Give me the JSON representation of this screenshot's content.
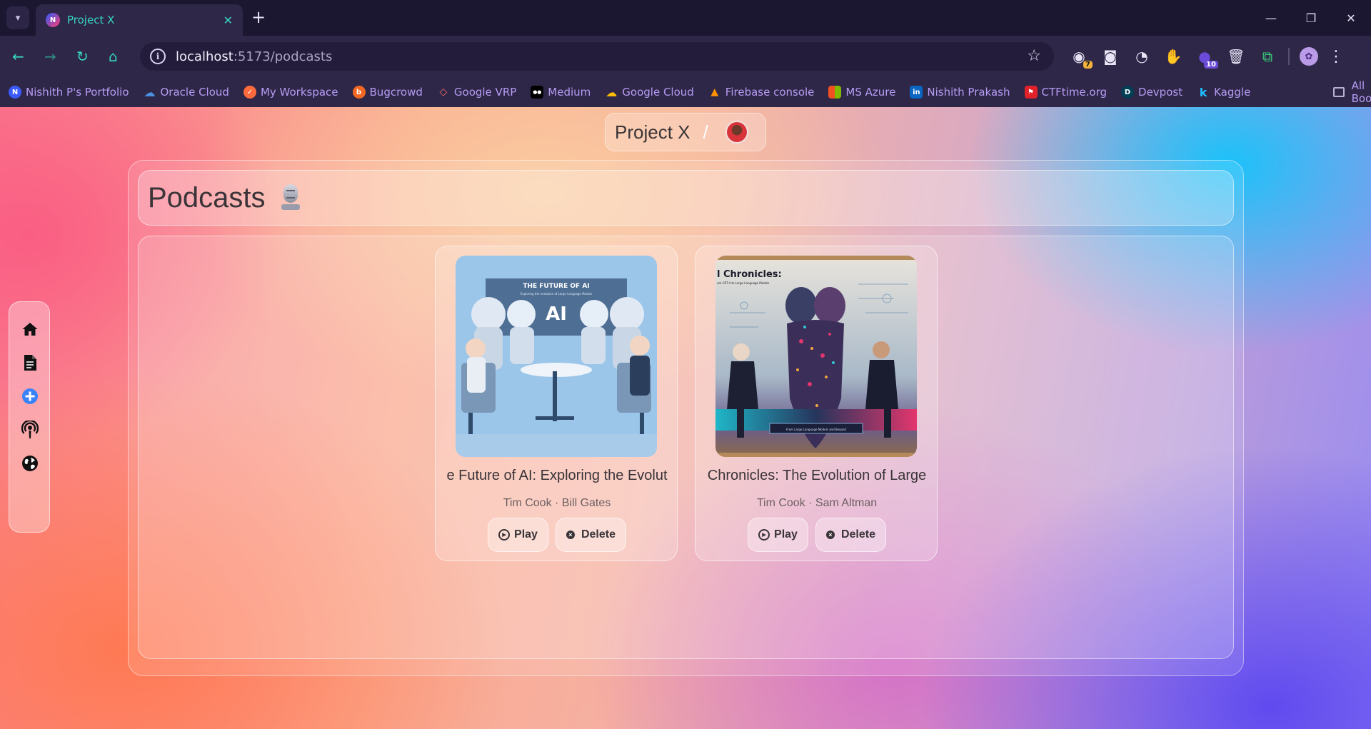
{
  "browser": {
    "tab_title": "Project X",
    "tab_favicon_text": "N",
    "url_host": "localhost",
    "url_path": ":5173/podcasts",
    "extensions": [
      {
        "icon": "extension-clock-icon",
        "badge": "7",
        "badge_color": "#f3b33d"
      },
      {
        "icon": "camera-icon"
      },
      {
        "icon": "speedometer-icon"
      },
      {
        "icon": "hand-stop-icon"
      },
      {
        "icon": "extension-purple-icon",
        "badge": "10",
        "badge_color": "#6c4bd8"
      },
      {
        "icon": "trash-icon"
      },
      {
        "icon": "puzzle-icon"
      }
    ],
    "bookmarks": [
      {
        "label": "Nishith P's Portfolio",
        "icon": "portfolio-icon",
        "color": "#3b5bff",
        "glyph": "N"
      },
      {
        "label": "Oracle Cloud",
        "icon": "cloud-icon",
        "color": "#4a8fe0",
        "glyph": "☁"
      },
      {
        "label": "My Workspace",
        "icon": "workspace-icon",
        "color": "#ff6a3d",
        "glyph": "✓"
      },
      {
        "label": "Bugcrowd",
        "icon": "bugcrowd-icon",
        "color": "#f26822",
        "glyph": "b"
      },
      {
        "label": "Google VRP",
        "icon": "google-vrp-icon",
        "color": "#2e2748",
        "glyph": "◇"
      },
      {
        "label": "Medium",
        "icon": "medium-icon",
        "color": "#000000",
        "glyph": "●●"
      },
      {
        "label": "Google Cloud",
        "icon": "google-cloud-icon",
        "color": "#4285f4",
        "glyph": "☁"
      },
      {
        "label": "Firebase console",
        "icon": "firebase-icon",
        "color": "#ff9100",
        "glyph": "▲"
      },
      {
        "label": "MS Azure",
        "icon": "ms-azure-icon",
        "color": "#00a4ef",
        "glyph": "▦"
      },
      {
        "label": "Nishith Prakash",
        "icon": "linkedin-icon",
        "color": "#0a66c2",
        "glyph": "in"
      },
      {
        "label": "CTFtime.org",
        "icon": "ctftime-icon",
        "color": "#e0212a",
        "glyph": "⚑"
      },
      {
        "label": "Devpost",
        "icon": "devpost-icon",
        "color": "#003e54",
        "glyph": "D"
      },
      {
        "label": "Kaggle",
        "icon": "kaggle-icon",
        "color": "#20beff",
        "glyph": "k"
      }
    ],
    "all_bookmarks": "All Bookmarks",
    "profile_glyph": "✿"
  },
  "app": {
    "breadcrumb_title": "Project X",
    "breadcrumb_sep": "/",
    "page_title": "Podcasts"
  },
  "sidebar": [
    {
      "icon": "home-icon"
    },
    {
      "icon": "document-icon"
    },
    {
      "icon": "add-circle-icon",
      "color": "#3b82f6"
    },
    {
      "icon": "podcast-icon"
    },
    {
      "icon": "globe-icon"
    }
  ],
  "podcasts": [
    {
      "title": "e Future of AI: Exploring the Evolut",
      "authors": "Tim Cook · Bill Gates",
      "cover_text": "THE FUTURE OF AI",
      "cover_sub": "Exploring the evolution of Large Language Models",
      "cover_badge": "AI",
      "play_label": "Play",
      "delete_label": "Delete"
    },
    {
      "title": "Chronicles: The Evolution of Large",
      "authors": "Tim Cook · Sam Altman",
      "cover_text": "l Chronicles:",
      "cover_sub": "om GPT-4 to Large Language Models",
      "cover_caption": "From Large Language Models and Beyond",
      "play_label": "Play",
      "delete_label": "Delete"
    }
  ]
}
